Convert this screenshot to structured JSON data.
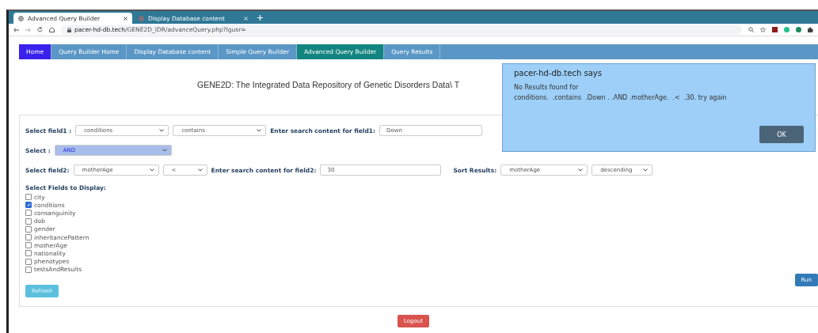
{
  "browser": {
    "tabs": [
      {
        "title": "Advanced Query Builder",
        "selected": true
      },
      {
        "title": "Display Database content",
        "selected": false
      }
    ],
    "url_host": "pacer-hd-db.tech",
    "url_path": "/GENE2D_IDR/advanceQuery.php?lgusr="
  },
  "nav": [
    {
      "label": "Home",
      "kind": "brand",
      "selected": false
    },
    {
      "label": "Query Builder Home",
      "kind": "link",
      "selected": false
    },
    {
      "label": "Display Database content",
      "kind": "link",
      "selected": false
    },
    {
      "label": "Simple Query Builder",
      "kind": "link",
      "selected": false
    },
    {
      "label": "Advanced Query Builder",
      "kind": "link",
      "selected": true
    },
    {
      "label": "Query Results",
      "kind": "link",
      "selected": false
    }
  ],
  "heading": "GENE2D: The Integrated Data Repository of Genetic Disorders Data\\ T",
  "form": {
    "field1": {
      "label": "Select field1 :",
      "field": "conditions",
      "operator": "contains",
      "search_label": "Enter search content for field1:",
      "search_value": "Down"
    },
    "join": {
      "label": "Select :",
      "value": "AND"
    },
    "field2": {
      "label": "Select field2:",
      "field": "motherAge",
      "operator": "<",
      "search_label": "Enter search content for field2:",
      "search_value": "30"
    },
    "sort": {
      "label": "Sort Results:",
      "field": "motherAge",
      "order": "descending"
    },
    "display_label": "Select Fields to Display:",
    "display_fields": [
      {
        "label": "city",
        "checked": false
      },
      {
        "label": "conditions",
        "checked": true
      },
      {
        "label": "consanguinity",
        "checked": false
      },
      {
        "label": "dob",
        "checked": false
      },
      {
        "label": "gender",
        "checked": false
      },
      {
        "label": "inheritancePattern",
        "checked": false
      },
      {
        "label": "motherAge",
        "checked": false
      },
      {
        "label": "nationality",
        "checked": false
      },
      {
        "label": "phenotypes",
        "checked": false
      },
      {
        "label": "testsAndResults",
        "checked": false
      }
    ],
    "refresh": "Refresh",
    "run": "Run"
  },
  "logout": "Logout",
  "dialog": {
    "title": "pacer-hd-db.tech says",
    "message_1": "No Results found for",
    "message_2": "conditions.  .contains  .Down . .AND .motherAge.  .<  .30. try again",
    "ok": "OK"
  }
}
